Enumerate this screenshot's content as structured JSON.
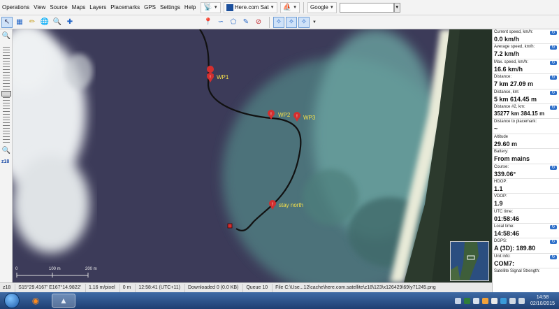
{
  "menu": {
    "items": [
      "Operations",
      "View",
      "Source",
      "Maps",
      "Layers",
      "Placemarks",
      "GPS",
      "Settings",
      "Help"
    ],
    "map_source": "Here.com Sat",
    "search_engine": "Google",
    "search_value": ""
  },
  "zoom": {
    "level": "z18"
  },
  "map": {
    "waypoints": [
      "WP1",
      "WP2",
      "WP3",
      "stay north"
    ],
    "scale": {
      "zero": "0",
      "mid": "100 m",
      "end": "200 m"
    }
  },
  "info_panel": [
    {
      "label": "Current speed, km/h:",
      "value": "0.0 km/h",
      "icon": true
    },
    {
      "label": "Average speed, km/h:",
      "value": "7.2 km/h",
      "icon": true
    },
    {
      "label": "Max. speed, km/h:",
      "value": "16.6 km/h",
      "icon": true
    },
    {
      "label": "Distance:",
      "value": "7 km 27.09 m",
      "icon": true
    },
    {
      "label": "Distance, km:",
      "value": "5 km 614.45 m",
      "icon": true
    },
    {
      "label": "Distance #2, km:",
      "value": "35277 km 384.15 m",
      "icon": true
    },
    {
      "label": "Distance to placemark:",
      "value": "~",
      "icon": false
    },
    {
      "label": "Altitude",
      "value": "29.60 m",
      "icon": false
    },
    {
      "label": "Battery:",
      "value": "From mains",
      "icon": false
    },
    {
      "label": "Course:",
      "value": "339.06°",
      "icon": true
    },
    {
      "label": "HDOP:",
      "value": "1.1",
      "icon": false
    },
    {
      "label": "VDOP:",
      "value": "1.9",
      "icon": false
    },
    {
      "label": "UTC time:",
      "value": "01:58:46",
      "icon": false
    },
    {
      "label": "Local time:",
      "value": "14:58:46",
      "icon": true
    },
    {
      "label": "DGPS:",
      "value": "A (3D): 189.80",
      "icon": true
    },
    {
      "label": "Unit info:",
      "value": "COM7:",
      "icon": true
    },
    {
      "label": "Satellite Signal Strength:",
      "value": "",
      "icon": false
    }
  ],
  "status_bar": {
    "zoom": "z18",
    "coordinates": "S15°29.4167' E167°14.9822'",
    "resolution": "1.16 m/pixel",
    "distance": "0 m",
    "time": "12:58:41 (UTC+11)",
    "downloaded": "Downloaded 0 (0.0 KB)",
    "queue": "Queue 10",
    "file": "File C:\\Use...12\\cache\\here.com.satellite\\z18\\123\\x126429\\69\\y71245.png"
  },
  "taskbar": {
    "clock_time": "14:58",
    "clock_date": "02/10/2015"
  },
  "colors": {
    "track": "#111111",
    "waypoint_marker": "#d32f2f",
    "waypoint_label": "#f5e04a",
    "info_icon": "#2e6fc9"
  }
}
